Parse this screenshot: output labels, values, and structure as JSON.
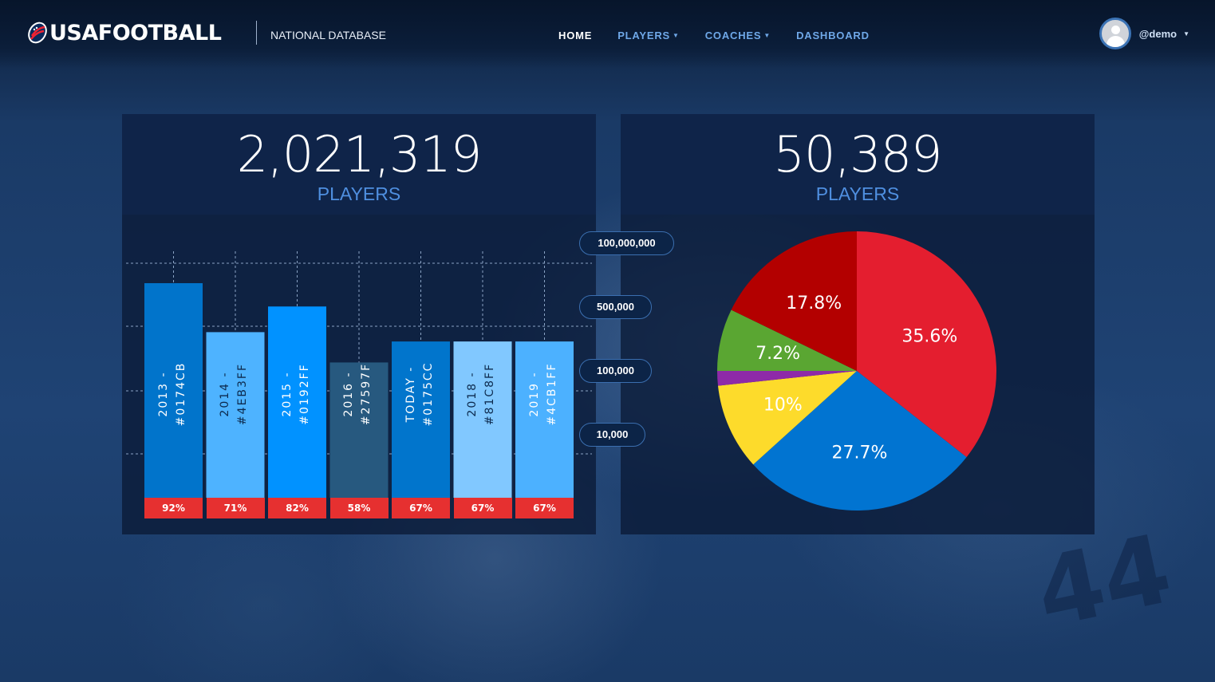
{
  "header": {
    "logo_text": "USAFOOTBALL",
    "subtitle": "NATIONAL DATABASE",
    "nav": [
      {
        "label": "HOME",
        "active": true,
        "dropdown": false
      },
      {
        "label": "PLAYERS",
        "active": false,
        "dropdown": true
      },
      {
        "label": "COACHES",
        "active": false,
        "dropdown": true
      },
      {
        "label": "DASHBOARD",
        "active": false,
        "dropdown": false
      }
    ],
    "user": {
      "username": "@demo"
    }
  },
  "left_panel": {
    "count": "2,021,319",
    "label": "PLAYERS"
  },
  "right_panel": {
    "count": "50,389",
    "label": "PLAYERS"
  },
  "scale_labels": [
    "100,000,000",
    "500,000",
    "100,000",
    "10,000"
  ],
  "chart_data": [
    {
      "type": "bar",
      "categories": [
        "2013 - #0174CB",
        "2014 - #4EB3FF",
        "2015 - #0192FF",
        "2016 - #27597F",
        "TODAY - #0175CC",
        "2018 - #81C8FF",
        "2019 - #4CB1FF"
      ],
      "colors": [
        "#0174CB",
        "#4EB3FF",
        "#0192FF",
        "#27597F",
        "#0175CC",
        "#81C8FF",
        "#4CB1FF"
      ],
      "label_colors": [
        "#ffffff",
        "#0d2a4d",
        "#ffffff",
        "#ffffff",
        "#ffffff",
        "#0d2a4d",
        "#ffffff"
      ],
      "values": [
        92,
        71,
        82,
        58,
        67,
        67,
        67
      ],
      "value_labels": [
        "92%",
        "71%",
        "82%",
        "58%",
        "67%",
        "67%",
        "67%"
      ],
      "ylim": [
        0,
        100
      ],
      "grid": true
    },
    {
      "type": "pie",
      "slices": [
        {
          "label": "35.6%",
          "value": 35.6,
          "color": "#e41e2f"
        },
        {
          "label": "27.7%",
          "value": 27.7,
          "color": "#0174d1"
        },
        {
          "label": "10%",
          "value": 10,
          "color": "#fddb2b"
        },
        {
          "label": "",
          "value": 1.7,
          "color": "#8e2aa8"
        },
        {
          "label": "7.2%",
          "value": 7.2,
          "color": "#5aa632"
        },
        {
          "label": "17.8%",
          "value": 17.8,
          "color": "#b30000"
        }
      ]
    }
  ]
}
